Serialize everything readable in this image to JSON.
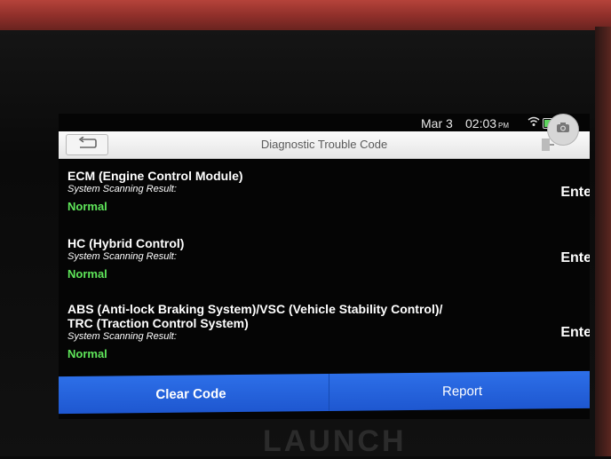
{
  "status_bar": {
    "date": "Mar 3",
    "time": "02:03",
    "ampm": "PM"
  },
  "header": {
    "title": "Diagnostic Trouble Code"
  },
  "modules": [
    {
      "name": "ECM (Engine Control Module)",
      "scan_label": "System Scanning Result:",
      "result": "Normal",
      "action": "Enter >"
    },
    {
      "name": "HC (Hybrid Control)",
      "scan_label": "System Scanning Result:",
      "result": "Normal",
      "action": "Enter >"
    },
    {
      "name_line1": "ABS (Anti-lock Braking System)/VSC (Vehicle Stability Control)/",
      "name_line2": "TRC (Traction Control System)",
      "scan_label": "System Scanning Result:",
      "result": "Normal",
      "action": "Enter >"
    }
  ],
  "footer": {
    "clear_label": "Clear Code",
    "report_label": "Report"
  },
  "brand": "LAUNCH",
  "colors": {
    "button_blue": "#2563e0",
    "normal_green": "#5fe65a",
    "header_bg": "#f2f2f2"
  }
}
